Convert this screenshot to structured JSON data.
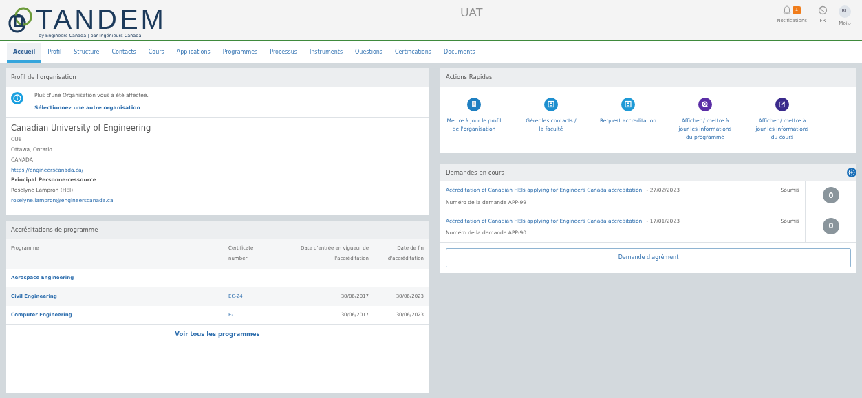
{
  "header": {
    "logo": {
      "wordmark": "TANDEM",
      "tagline": "by Engineers Canada | par Ingénieurs Canada"
    },
    "environment": "UAT",
    "notifications": {
      "count": "1",
      "label": "Notifications"
    },
    "language": "FR",
    "user": {
      "initials": "RL",
      "label": "Moi"
    }
  },
  "tabs": [
    {
      "label": "Accueil",
      "selected": true
    },
    {
      "label": "Profil",
      "selected": false
    },
    {
      "label": "Structure",
      "selected": false
    },
    {
      "label": "Contacts",
      "selected": false
    },
    {
      "label": "Cours",
      "selected": false
    },
    {
      "label": "Applications",
      "selected": false
    },
    {
      "label": "Programmes",
      "selected": false
    },
    {
      "label": "Processus",
      "selected": false
    },
    {
      "label": "Instruments",
      "selected": false
    },
    {
      "label": "Questions",
      "selected": false
    },
    {
      "label": "Certifications",
      "selected": false
    },
    {
      "label": "Documents",
      "selected": false
    }
  ],
  "organization_profile": {
    "title": "Profil de l'organisation",
    "notice": "Plus d'une Organisation vous a été affectée.",
    "notice_link": "Sélectionnez une autre organisation",
    "name": "Canadian University of Engineering",
    "lines": [
      "CUE",
      "Ottawa, Ontario",
      "CANADA"
    ],
    "website": "https://engineerscanada.ca/",
    "contact_heading": "Principal Personne-ressource",
    "contact_name": "Roselyne Lampron (HEI)",
    "contact_email": "roselyne.lampron@engineerscanada.ca"
  },
  "program_accreditations": {
    "title": "Accréditations de programme",
    "columns": [
      "Programme",
      "Certificate number",
      "Date d'entrée en vigueur de l'accréditation",
      "Date de fin d'accréditation"
    ],
    "rows": [
      {
        "program": "Aerospace Engineering"
      },
      {
        "program": "Civil Engineering",
        "certificate": "EC-24",
        "start": "30/06/2017",
        "end": "30/06/2023"
      },
      {
        "program": "Computer Engineering",
        "certificate": "E-1",
        "start": "30/06/2017",
        "end": "30/06/2023"
      }
    ],
    "footer_link": "Voir tous les programmes"
  },
  "quick_actions": {
    "title": "Actions Rapides",
    "items": [
      {
        "label": "Mettre à jour le profil de l'organisation",
        "kind": "document",
        "color": "#1e7fc1"
      },
      {
        "label": "Gérer les contacts / la faculté",
        "kind": "contact",
        "color": "#1e8fcf"
      },
      {
        "label": "Request accreditation",
        "kind": "contact",
        "color": "#1e9ad6"
      },
      {
        "label": "Afficher / mettre à jour les informations du programme",
        "kind": "search",
        "color": "#5b2ea6"
      },
      {
        "label": "Afficher / mettre à jour les informations du cours",
        "kind": "edit",
        "color": "#3a2a8c"
      }
    ]
  },
  "requests": {
    "title": "Demandes en cours",
    "items": [
      {
        "title": "Accreditation of Canadian HEIs applying for Engineers Canada accreditation.",
        "date": "- 27/02/2023",
        "number": "Numéro de la demande APP-99",
        "status": "Soumis",
        "count": "0"
      },
      {
        "title": "Accreditation of Canadian HEIs applying for Engineers Canada accreditation.",
        "date": "- 17/01/2023",
        "number": "Numéro de la demande APP-90",
        "status": "Soumis",
        "count": "0"
      }
    ],
    "button": "Demande d'agrément"
  }
}
